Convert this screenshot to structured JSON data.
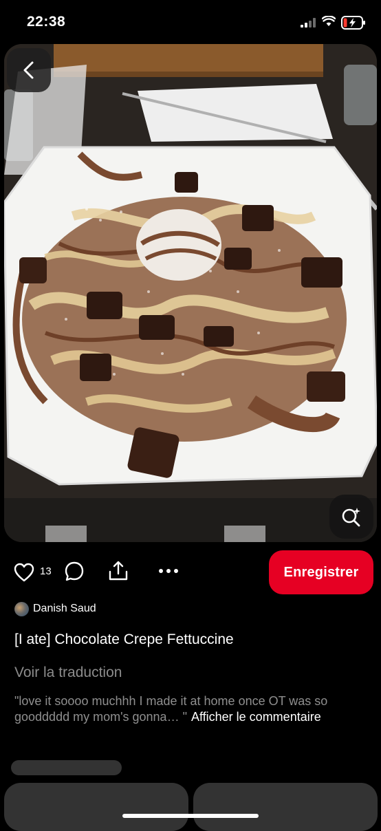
{
  "status_bar": {
    "time": "22:38"
  },
  "pin": {
    "likes": "13",
    "save_label": "Enregistrer",
    "author": "Danish Saud",
    "title": "[I ate] Chocolate Crepe Fettuccine",
    "translate_label": "Voir la traduction",
    "comment_preview": "\"love it soooo muchhh I made it at home once OT was so gooddddd my mom's gonna… \"",
    "comment_link": "Afficher le commentaire"
  },
  "colors": {
    "accent": "#e60023",
    "background": "#000000",
    "muted": "#8c8c8c"
  },
  "icons": [
    "back-arrow-icon",
    "visual-search-icon",
    "heart-icon",
    "comment-icon",
    "share-icon",
    "more-icon",
    "signal-icon",
    "wifi-icon",
    "battery-icon"
  ]
}
